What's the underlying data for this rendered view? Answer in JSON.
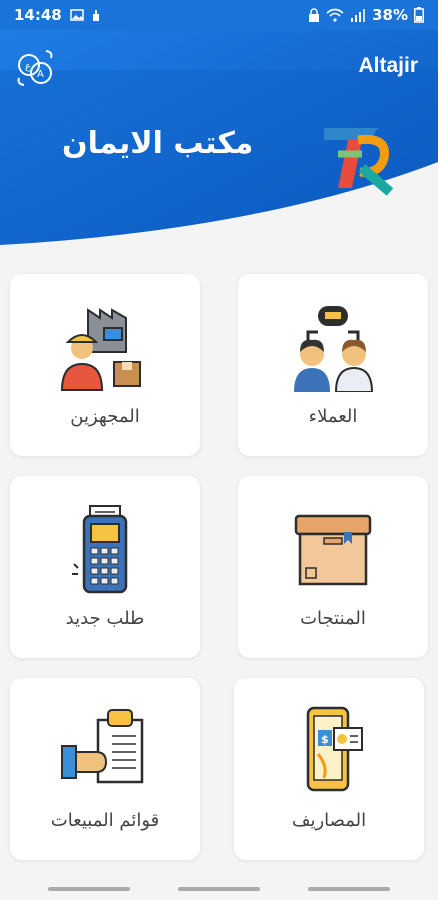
{
  "status": {
    "time": "14:48",
    "battery": "38%"
  },
  "header": {
    "app_name": "Altajir",
    "shop_name": "مكتب الايمان"
  },
  "menu": [
    {
      "key": "customers",
      "label": "العملاء"
    },
    {
      "key": "suppliers",
      "label": "المجهزين"
    },
    {
      "key": "products",
      "label": "المنتجات"
    },
    {
      "key": "new_order",
      "label": "طلب جديد"
    },
    {
      "key": "expenses",
      "label": "المصاريف"
    },
    {
      "key": "sales_lists",
      "label": "قوائم المبيعات"
    }
  ],
  "colors": {
    "primary": "#1a73d9",
    "header_dark": "#0d5fc4",
    "background": "#f4f4f4"
  }
}
